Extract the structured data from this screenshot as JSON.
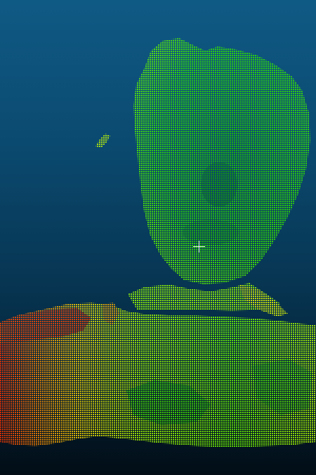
{
  "scene": {
    "background_top": "#0f5a85",
    "background_bottom": "#020d16",
    "colormap": [
      "#ff3300",
      "#ff8a00",
      "#ffe600",
      "#b8ff00",
      "#38ff00"
    ],
    "pointer_icon": "crosshair-icon"
  }
}
